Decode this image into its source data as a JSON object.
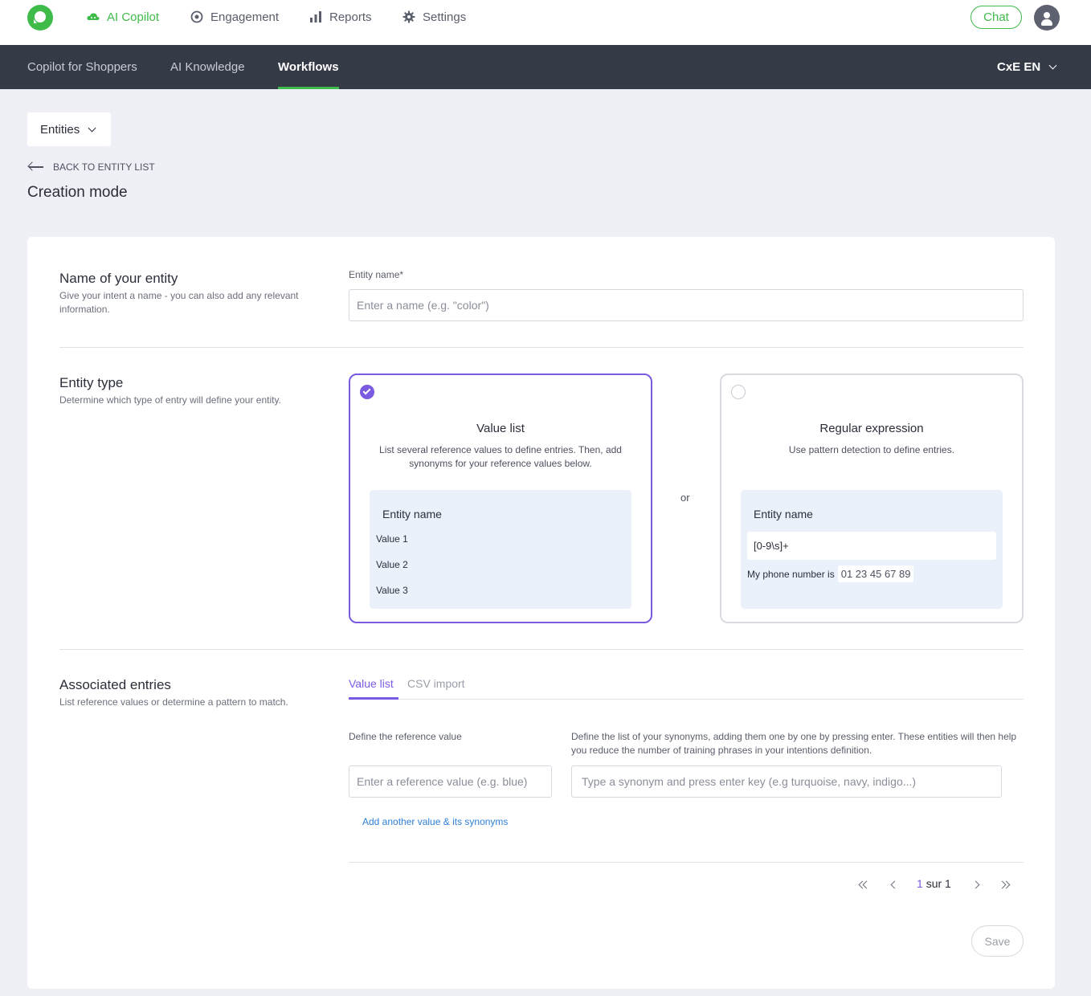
{
  "topbar": {
    "nav": [
      {
        "label": "AI Copilot",
        "icon": "cloud-icon",
        "active": true
      },
      {
        "label": "Engagement",
        "icon": "target-icon",
        "active": false
      },
      {
        "label": "Reports",
        "icon": "bar-chart-icon",
        "active": false
      },
      {
        "label": "Settings",
        "icon": "gear-icon",
        "active": false
      }
    ],
    "chat_label": "Chat",
    "brand_color": "#3fbb4a"
  },
  "subbar": {
    "tabs": [
      {
        "label": "Copilot for Shoppers",
        "active": false
      },
      {
        "label": "AI Knowledge",
        "active": false
      },
      {
        "label": "Workflows",
        "active": true
      }
    ],
    "language": "CxE EN"
  },
  "header": {
    "dropdown_label": "Entities",
    "back_label": "BACK TO ENTITY LIST",
    "title": "Creation mode"
  },
  "name_section": {
    "title": "Name of your entity",
    "description": "Give your intent a name - you can also add any relevant information.",
    "field_label": "Entity name*",
    "placeholder": "Enter a name (e.g. \"color\")"
  },
  "type_section": {
    "title": "Entity type",
    "description": "Determine which type of entry will define your entity.",
    "or_label": "or",
    "value_list": {
      "title": "Value list",
      "description": "List several reference values to define entries. Then, add synonyms for your reference values below.",
      "preview_title": "Entity name",
      "values": [
        "Value 1",
        "Value 2",
        "Value 3"
      ],
      "selected": true
    },
    "regex": {
      "title": "Regular expression",
      "description": "Use pattern detection to define entries.",
      "preview_title": "Entity name",
      "pattern": "[0-9\\s]+",
      "example_prefix": "My phone number is",
      "example_match": "01 23 45 67 89",
      "selected": false
    },
    "accent_color": "#7a5ae0"
  },
  "entries_section": {
    "title": "Associated entries",
    "description": "List reference values or determine a pattern to match.",
    "tabs": [
      {
        "label": "Value list",
        "active": true
      },
      {
        "label": "CSV import",
        "active": false
      }
    ],
    "reference_label": "Define the reference value",
    "reference_placeholder": "Enter a reference value (e.g. blue)",
    "synonyms_label": "Define the list of your synonyms, adding them one by one by pressing enter. These entities will then help you reduce the number of training phrases in your intentions definition.",
    "synonyms_placeholder": "Type a synonym and press enter key (e.g turquoise, navy, indigo...)",
    "add_link": "Add another value & its synonyms"
  },
  "pagination": {
    "current": "1",
    "suffix": "sur 1"
  },
  "save_label": "Save"
}
